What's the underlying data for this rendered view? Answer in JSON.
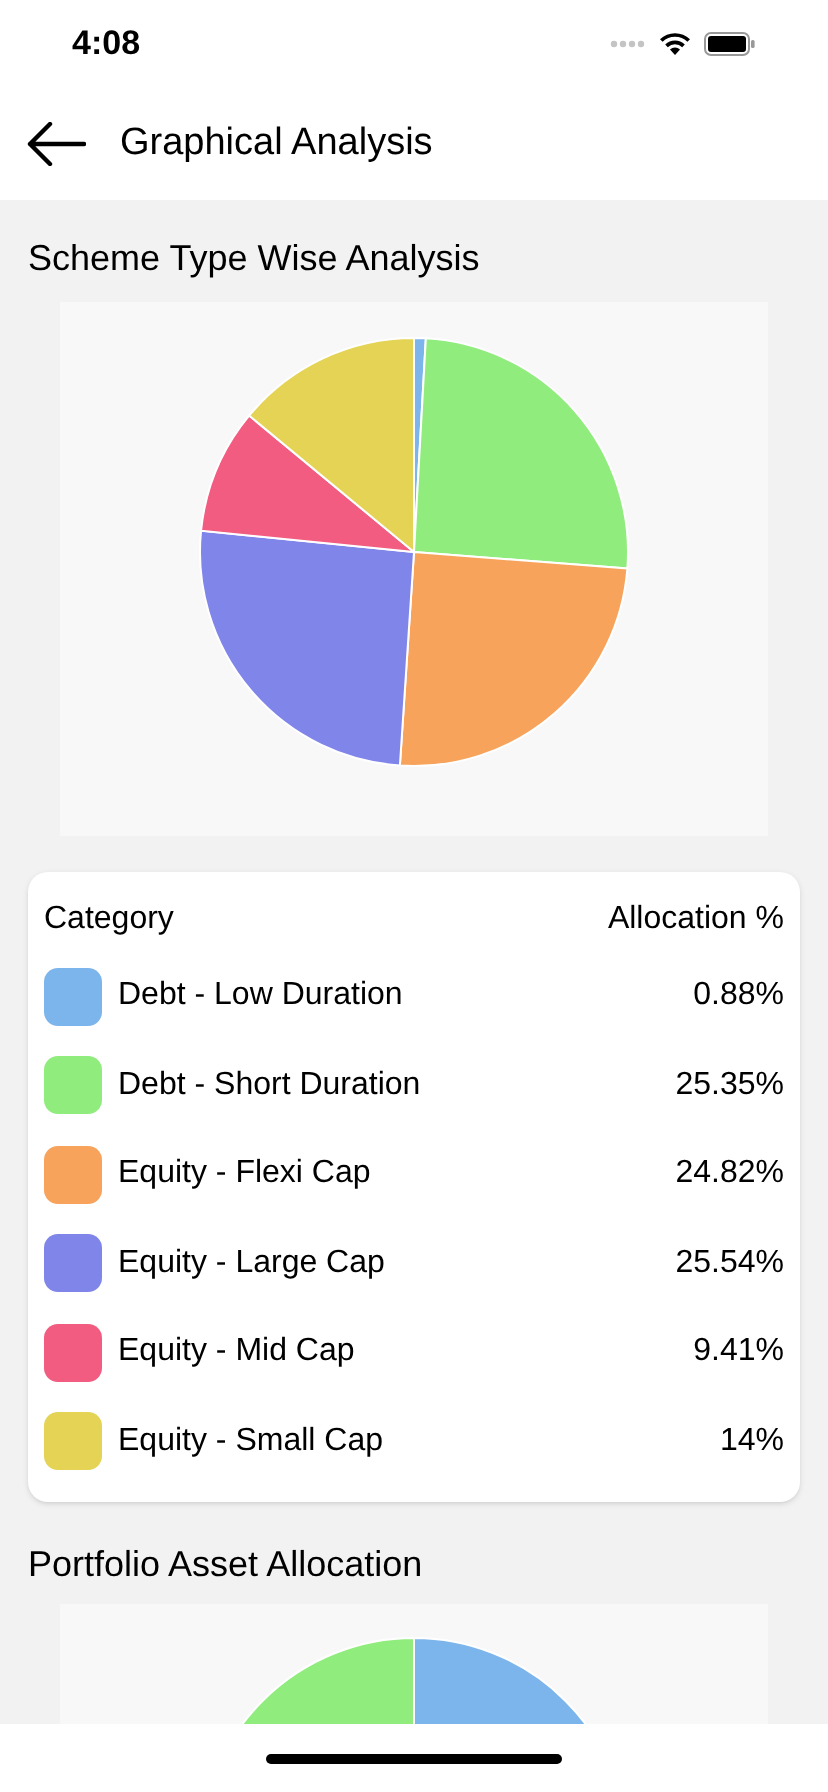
{
  "status_bar": {
    "time": "4:08"
  },
  "header": {
    "title": "Graphical Analysis"
  },
  "scheme_section": {
    "title": "Scheme Type Wise Analysis",
    "chart_data": {
      "type": "pie",
      "values": [
        0.88,
        25.35,
        24.82,
        25.54,
        9.41,
        14
      ]
    }
  },
  "allocation_table": {
    "columns": [
      "Category",
      "Allocation %"
    ],
    "rows": [
      {
        "category": "Debt - Low Duration",
        "allocation": "0.88%",
        "color": "#7cb5ec"
      },
      {
        "category": "Debt - Short Duration",
        "allocation": "25.35%",
        "color": "#90ed7d"
      },
      {
        "category": "Equity - Flexi Cap",
        "allocation": "24.82%",
        "color": "#f7a35c"
      },
      {
        "category": "Equity - Large Cap",
        "allocation": "25.54%",
        "color": "#8085e9"
      },
      {
        "category": "Equity - Mid Cap",
        "allocation": "9.41%",
        "color": "#f15c80"
      },
      {
        "category": "Equity - Small Cap",
        "allocation": "14%",
        "color": "#e4d354"
      }
    ]
  },
  "portfolio_section": {
    "title": "Portfolio Asset Allocation"
  }
}
